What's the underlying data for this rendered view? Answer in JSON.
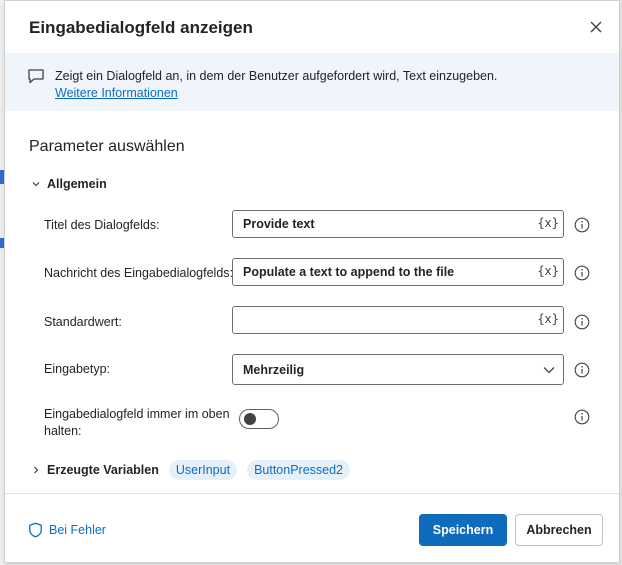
{
  "dialog": {
    "title": "Eingabedialogfeld anzeigen",
    "info_text": "Zeigt ein Dialogfeld an, in dem der Benutzer aufgefordert wird, Text einzugeben.",
    "info_link": "Weitere Informationen"
  },
  "parameters": {
    "heading": "Parameter auswählen",
    "group_label": "Allgemein",
    "dialog_title": {
      "label": "Titel des Dialogfelds:",
      "value": "Provide text",
      "var_icon": "{x}"
    },
    "message": {
      "label": "Nachricht des Eingabedialogfelds:",
      "value": "Populate a text to append to the file",
      "var_icon": "{x}"
    },
    "default_value": {
      "label": "Standardwert:",
      "value": "",
      "var_icon": "{x}"
    },
    "input_type": {
      "label": "Eingabetyp:",
      "value": "Mehrzeilig"
    },
    "keep_on_top": {
      "label_line1": "Eingabedialogfeld immer im oben",
      "label_line2": "halten:",
      "enabled": false
    }
  },
  "variables": {
    "label": "Erzeugte Variablen",
    "items": [
      "UserInput",
      "ButtonPressed2"
    ]
  },
  "footer": {
    "on_error": "Bei Fehler",
    "save": "Speichern",
    "cancel": "Abbrechen"
  },
  "colors": {
    "accent": "#0f6cbd",
    "banner": "#f0f5fc"
  }
}
